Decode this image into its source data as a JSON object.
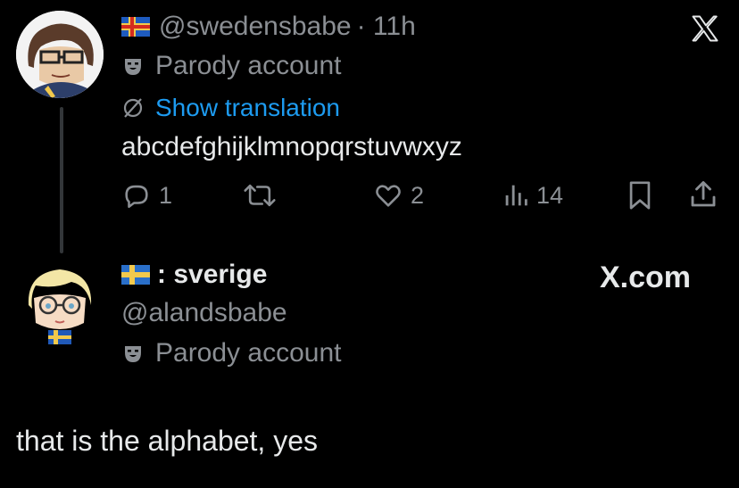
{
  "tweet1": {
    "handle": "@swedensbabe",
    "time": "· 11h",
    "parody_label": "Parody account",
    "show_translation": "Show translation",
    "text": "abcdefghijklmnopqrstuvwxyz",
    "actions": {
      "replies": "1",
      "likes": "2",
      "views": "14"
    }
  },
  "tweet2": {
    "display_name": ": sverige",
    "handle": "@alandsbabe",
    "parody_label": "Parody account",
    "watermark": "X.com",
    "text": "that is the alphabet, yes"
  },
  "icons": [
    "aland-flag-icon",
    "x-logo-icon",
    "parody-mask-icon",
    "translate-icon",
    "reply-icon",
    "repost-icon",
    "like-icon",
    "views-icon",
    "bookmark-icon",
    "share-icon",
    "sweden-flag-icon"
  ],
  "colors": {
    "background": "#000000",
    "text": "#e7e9ea",
    "muted": "#8b8f94",
    "link": "#1d9bf0"
  }
}
